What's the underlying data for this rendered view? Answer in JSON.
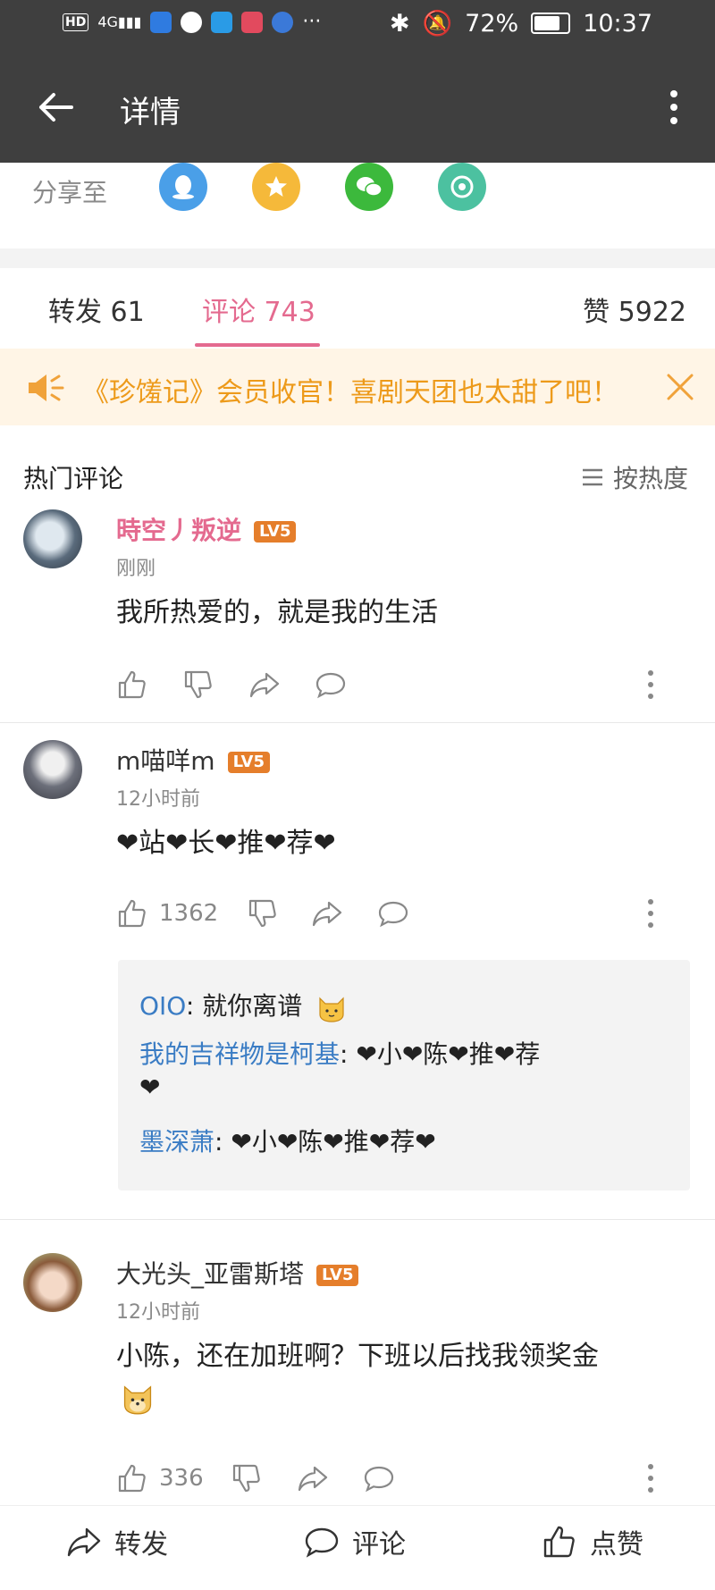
{
  "status_bar": {
    "battery": "72%",
    "time": "10:37"
  },
  "app_bar": {
    "title": "详情"
  },
  "share": {
    "label": "分享至",
    "targets": [
      "qq",
      "favorite",
      "wechat",
      "moments"
    ]
  },
  "tabs": [
    {
      "label": "转发 61"
    },
    {
      "label": "评论 743",
      "active": true
    },
    {
      "label": "赞 5922"
    }
  ],
  "banner": {
    "text": "《珍馐记》会员收官！喜剧天团也太甜了吧！"
  },
  "section": {
    "title": "热门评论",
    "sort_label": "按热度"
  },
  "comments": [
    {
      "user": "時空丿叛逆",
      "level": "LV5",
      "time": "刚刚",
      "text": "我所热爱的，就是我的生活",
      "likes": ""
    },
    {
      "user": "m喵咩m",
      "level": "LV5",
      "time": "12小时前",
      "text": "❤站❤长❤推❤荐❤",
      "likes": "1362",
      "replies": [
        {
          "name": "OΙO",
          "sep": ": ",
          "text": "就你离谱"
        },
        {
          "name": "我的吉祥物是柯基",
          "sep": ": ",
          "text": "❤小❤陈❤推❤荐",
          "text2": "❤"
        },
        {
          "name": "墨深萧",
          "sep": ": ",
          "text": "❤小❤陈❤推❤荐❤"
        }
      ]
    },
    {
      "user": "大光头_亚雷斯塔",
      "level": "LV5",
      "time": "12小时前",
      "text": "小陈，还在加班啊？下班以后找我领奖金",
      "likes": "336"
    }
  ],
  "bottom_bar": {
    "repost": "转发",
    "comment": "评论",
    "like": "点赞"
  },
  "colors": {
    "accent": "#e46a8f",
    "banner_text": "#ed9a1a",
    "reply_name": "#3a7cc4",
    "level_badge": "#e57e2b"
  }
}
